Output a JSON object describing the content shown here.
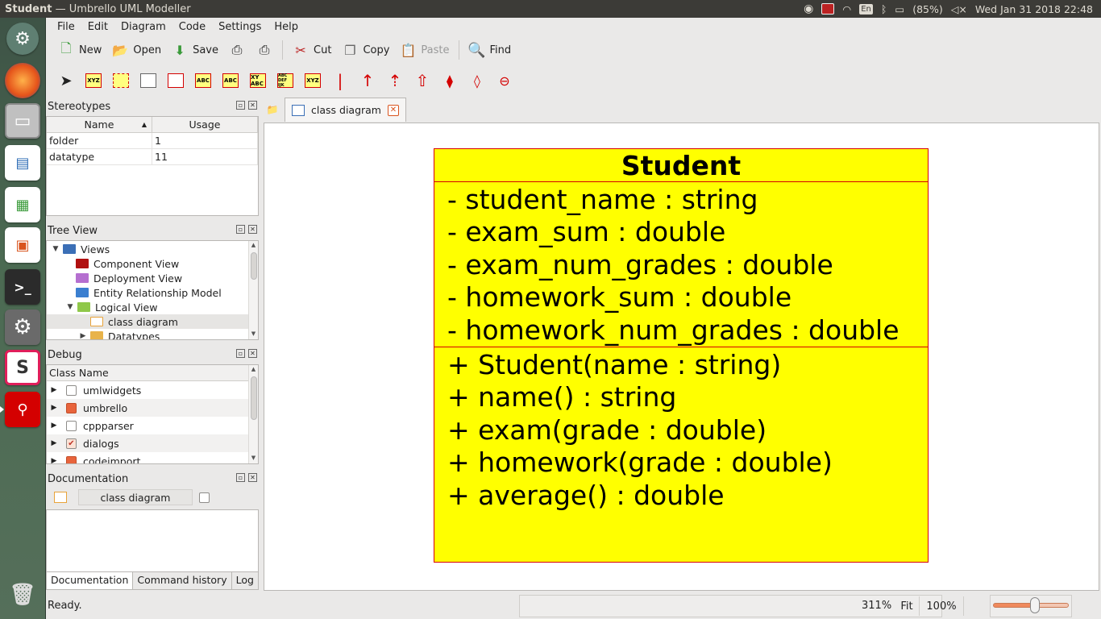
{
  "window": {
    "title_app": "Student",
    "title_rest": " — Umbrello UML Modeller"
  },
  "indicators": {
    "lang": "En",
    "battery": "(85%)",
    "datetime": "Wed Jan 31 2018 22:48"
  },
  "menu": [
    "File",
    "Edit",
    "Diagram",
    "Code",
    "Settings",
    "Help"
  ],
  "toolbar": {
    "new": "New",
    "open": "Open",
    "save": "Save",
    "cut": "Cut",
    "copy": "Copy",
    "paste": "Paste",
    "find": "Find"
  },
  "tools": {
    "xyz1": "XYZ",
    "abc": "ABC",
    "xyzabc": "XY ABC",
    "abcdef": "ABC DEF IJK",
    "xyz2": "XYZ"
  },
  "stereotypes": {
    "title": "Stereotypes",
    "col_name": "Name",
    "col_usage": "Usage",
    "rows": [
      {
        "name": "folder",
        "usage": "1"
      },
      {
        "name": "datatype",
        "usage": "11"
      }
    ]
  },
  "treeview": {
    "title": "Tree View",
    "items": [
      {
        "label": "Views",
        "color": "#3b6fb6"
      },
      {
        "label": "Component View",
        "color": "#b01010"
      },
      {
        "label": "Deployment View",
        "color": "#b56fd0"
      },
      {
        "label": "Entity Relationship Model",
        "color": "#3b7fd0"
      },
      {
        "label": "Logical View",
        "color": "#8fc84a"
      },
      {
        "label": "class diagram",
        "color": "#e8a33a"
      },
      {
        "label": "Datatypes",
        "color": "#e8b34a"
      }
    ]
  },
  "debug": {
    "title": "Debug",
    "col_class": "Class Name",
    "rows": [
      {
        "label": "umlwidgets"
      },
      {
        "label": "umbrello"
      },
      {
        "label": "cppparser"
      },
      {
        "label": "dialogs"
      },
      {
        "label": "codeimport"
      }
    ]
  },
  "documentation": {
    "title": "Documentation",
    "diagram_name": "class diagram",
    "tabs": [
      "Documentation",
      "Command history",
      "Log"
    ]
  },
  "diagram": {
    "tab_label": "class diagram",
    "class_name": "Student",
    "attributes": [
      "- student_name : string",
      "- exam_sum : double",
      "- exam_num_grades : double",
      "- homework_sum : double",
      "- homework_num_grades : double"
    ],
    "operations": [
      "+ Student(name : string)",
      "+ name() : string",
      "+ exam(grade : double)",
      "+ homework(grade : double)",
      "+ average() : double"
    ]
  },
  "status": {
    "text": "Ready.",
    "zoom": "311%",
    "fit": "Fit",
    "hundred": "100%",
    "zoom_level": 0.55
  }
}
